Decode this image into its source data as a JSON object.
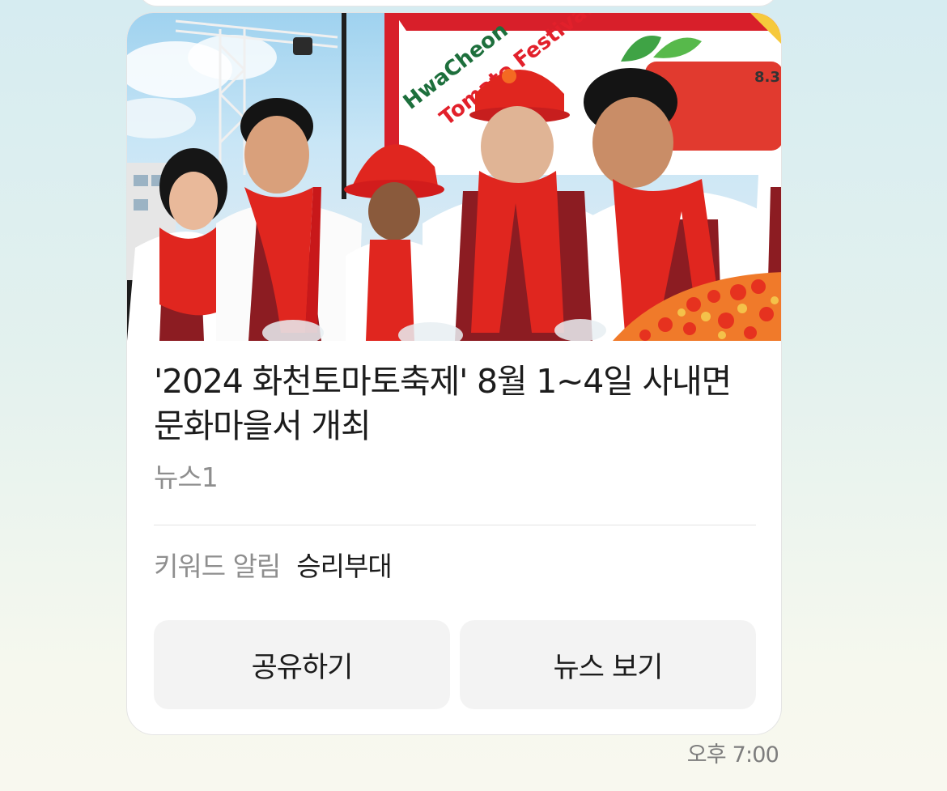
{
  "message": {
    "headline": "'2024 화천토마토축제' 8월 1~4일 사내면 문화마을서 개최",
    "source": "뉴스1",
    "keyword_label": "키워드 알림",
    "keyword_value": "승리부대",
    "share_label": "공유하기",
    "view_label": "뉴스 보기",
    "time": "오후 7:00",
    "photo_description": "Festival participants in red hats, red scarves and aprons mixing tomatoes",
    "photo_banner_text": "HwaCheon Tomato Festival",
    "photo_banner_date": "8.3"
  },
  "colors": {
    "accent_red": "#e0261f",
    "apron": "#8c1c22",
    "button_bg": "#f3f3f3",
    "muted_text": "#8e8e8e",
    "body_text": "#1c1c1c"
  }
}
